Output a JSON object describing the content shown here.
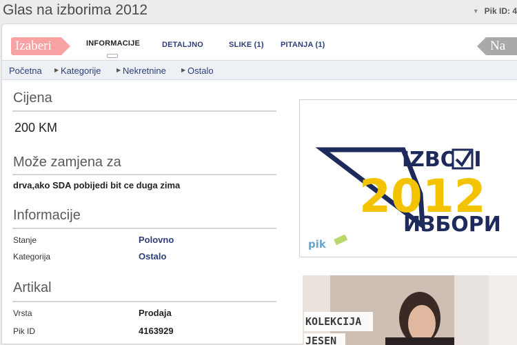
{
  "page": {
    "title": "Glas na izborima 2012",
    "pik_label": "Pik ID: 4"
  },
  "tabs": {
    "izaberi": "Izaberi",
    "items": [
      {
        "label": "INFORMACIJE"
      },
      {
        "label": "DETALJNO"
      },
      {
        "label": "SLIKE (1)"
      },
      {
        "label": "PITANJA (1)"
      }
    ],
    "next_label": "Na"
  },
  "breadcrumb": [
    "Početna",
    "Kategorije",
    "Nekretnine",
    "Ostalo"
  ],
  "cijena": {
    "title": "Cijena",
    "value": "200 KM"
  },
  "zamjena": {
    "title": "Može zamjena za",
    "value": "drva,ako SDA pobijedi bit ce duga zima"
  },
  "informacije": {
    "title": "Informacije",
    "rows": [
      {
        "label": "Stanje",
        "value": "Polovno"
      },
      {
        "label": "Kategorija",
        "value": "Ostalo"
      }
    ]
  },
  "artikal": {
    "title": "Artikal",
    "rows": [
      {
        "label": "Vrsta",
        "value": "Prodaja"
      },
      {
        "label": "Pik ID",
        "value": "4163929"
      }
    ]
  },
  "ad_izbori": {
    "top_word": "IZBORI",
    "year": "2012",
    "bottom_word": "ИЗБОРИ",
    "brand": "pik",
    "colors": {
      "navy": "#1e2a5c",
      "yellow": "#f3c300",
      "blue": "#2c5bb8"
    }
  },
  "ad_fashion": {
    "line1": "KOLEKCIJA",
    "line2": "JESEN"
  }
}
